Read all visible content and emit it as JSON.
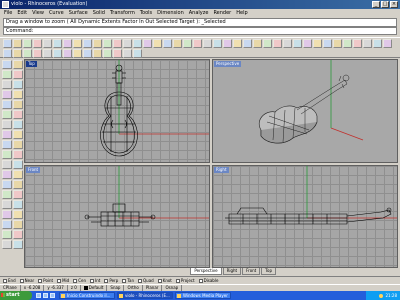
{
  "window": {
    "title": "violo - Rhinoceros (Evaluation)"
  },
  "menu": [
    "File",
    "Edit",
    "View",
    "Curve",
    "Surface",
    "Solid",
    "Transform",
    "Tools",
    "Dimension",
    "Analyze",
    "Render",
    "Help"
  ],
  "command": {
    "history": "Drag a window to zoom ( All  Dynamic  Extents  Factor  In  Out  Selected  Target ): _Selected",
    "prompt": "Command:"
  },
  "viewports": [
    {
      "label": "Top",
      "active": true
    },
    {
      "label": "Perspective",
      "active": false
    },
    {
      "label": "Front",
      "active": false
    },
    {
      "label": "Right",
      "active": false
    }
  ],
  "viewport_tabs": [
    "Perspective",
    "Right",
    "Front",
    "Top"
  ],
  "osnaps": [
    "End",
    "Near",
    "Point",
    "Mid",
    "Cen",
    "Int",
    "Perp",
    "Tan",
    "Quad",
    "Knot",
    "Project",
    "Disable"
  ],
  "status": {
    "cplane": "CPlane",
    "x": "x -6.208",
    "y": "y -6.337",
    "z": "z 0",
    "layer": "Default",
    "modes": [
      "Snap",
      "Ortho",
      "Planar",
      "Osnap"
    ]
  },
  "taskbar": {
    "start": "start",
    "tasks": [
      "Inicio Construindo il...",
      "violo - Rhinoceros (E...",
      "Windows Media Player"
    ],
    "clock": "21:28"
  },
  "colors": {
    "title": "#0a246a",
    "accent": "#1a3b8c",
    "axis_x": "#c0302c",
    "axis_y": "#2a9a3a",
    "taskbar": "#245edb"
  }
}
